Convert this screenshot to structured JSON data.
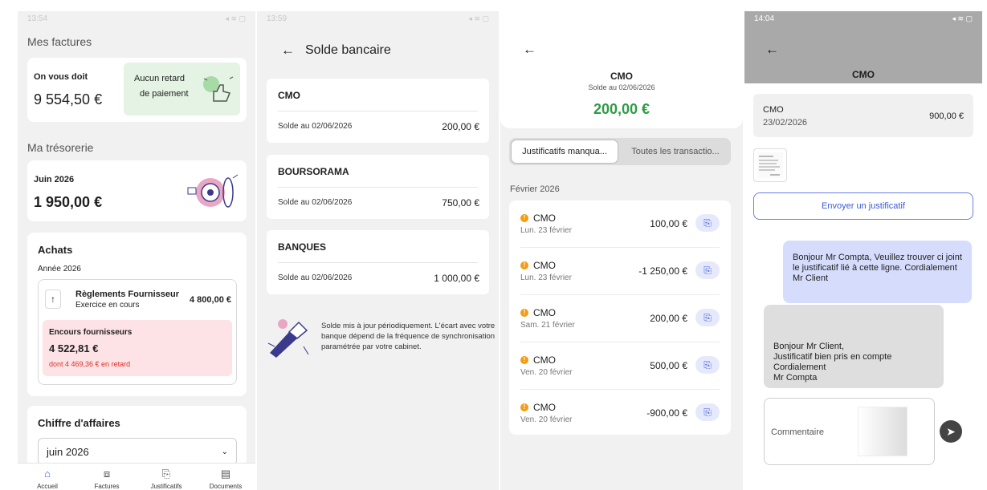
{
  "screen1": {
    "status_time": "13:54",
    "invoices_title": "Mes factures",
    "owed_label": "On vous doit",
    "owed_amount": "9 554,50 €",
    "no_delay_line1": "Aucun retard",
    "no_delay_line2": "de paiement",
    "treasury_title": "Ma trésorerie",
    "treasury_month": "Juin 2026",
    "treasury_amount": "1 950,00 €",
    "purchases_title": "Achats",
    "purchases_year": "Année 2026",
    "supplier_payments_label": "Règlements Fournisseur",
    "supplier_payments_sub": "Exercice en cours",
    "supplier_payments_amount": "4 800,00 €",
    "outstanding_label": "Encours fournisseurs",
    "outstanding_amount": "4 522,81 €",
    "outstanding_late": "dont 4 469,36 € en retard",
    "revenue_title": "Chiffre d'affaires",
    "revenue_select": "juin 2026",
    "nav": [
      {
        "label": "Accueil",
        "icon": "home-icon",
        "glyph": "⌂"
      },
      {
        "label": "Factures",
        "icon": "scan-icon",
        "glyph": "⧈"
      },
      {
        "label": "Justificatifs",
        "icon": "paperclip-icon",
        "glyph": "⎘"
      },
      {
        "label": "Documents",
        "icon": "document-icon",
        "glyph": "▤"
      }
    ]
  },
  "screen2": {
    "status_time": "13:59",
    "title": "Solde bancaire",
    "back_icon": "←",
    "banks": [
      {
        "name": "CMO",
        "date": "Solde au 02/06/2026",
        "amount": "200,00 €"
      },
      {
        "name": "BOURSORAMA",
        "date": "Solde au 02/06/2026",
        "amount": "750,00 €"
      },
      {
        "name": "BANQUES",
        "date": "Solde au 02/06/2026",
        "amount": "1 000,00 €"
      }
    ],
    "info_text": "Solde mis à jour périodiquement. L'écart avec votre banque dépend de la fréquence de synchronisation paramétrée par votre cabinet."
  },
  "screen3": {
    "back_icon": "←",
    "bank_name": "CMO",
    "balance_date": "Solde au 02/06/2026",
    "balance_amount": "200,00 €",
    "tab_missing": "Justificatifs manqua...",
    "tab_all": "Toutes les transactio...",
    "month": "Février 2026",
    "transactions": [
      {
        "name": "CMO",
        "date": "Lun. 23 février",
        "amount": "100,00 €"
      },
      {
        "name": "CMO",
        "date": "Lun. 23 février",
        "amount": "-1 250,00 €"
      },
      {
        "name": "CMO",
        "date": "Sam. 21 février",
        "amount": "200,00 €"
      },
      {
        "name": "CMO",
        "date": "Ven. 20 février",
        "amount": "500,00 €"
      },
      {
        "name": "CMO",
        "date": "Ven. 20 février",
        "amount": "-900,00 €"
      }
    ]
  },
  "screen4": {
    "status_time": "14:04",
    "back_icon": "←",
    "title": "CMO",
    "tx_name": "CMO",
    "tx_date": "23/02/2026",
    "tx_amount": "900,00 €",
    "send_button": "Envoyer un justificatif",
    "msg_client": "Bonjour Mr Compta, Veuillez trouver ci joint le justificatif lié à cette ligne. Cordialement Mr Client",
    "msg_accountant_l1": "Bonjour Mr Client,",
    "msg_accountant_l2": "Justificatif bien pris en compte",
    "msg_accountant_l3": "Cordialement",
    "msg_accountant_l4": "Mr Compta",
    "comment_placeholder": "Commentaire"
  },
  "colors": {
    "accent": "#3b5bdb",
    "positive": "#2e9b45",
    "late": "#d93025",
    "warning": "#f39c12"
  }
}
